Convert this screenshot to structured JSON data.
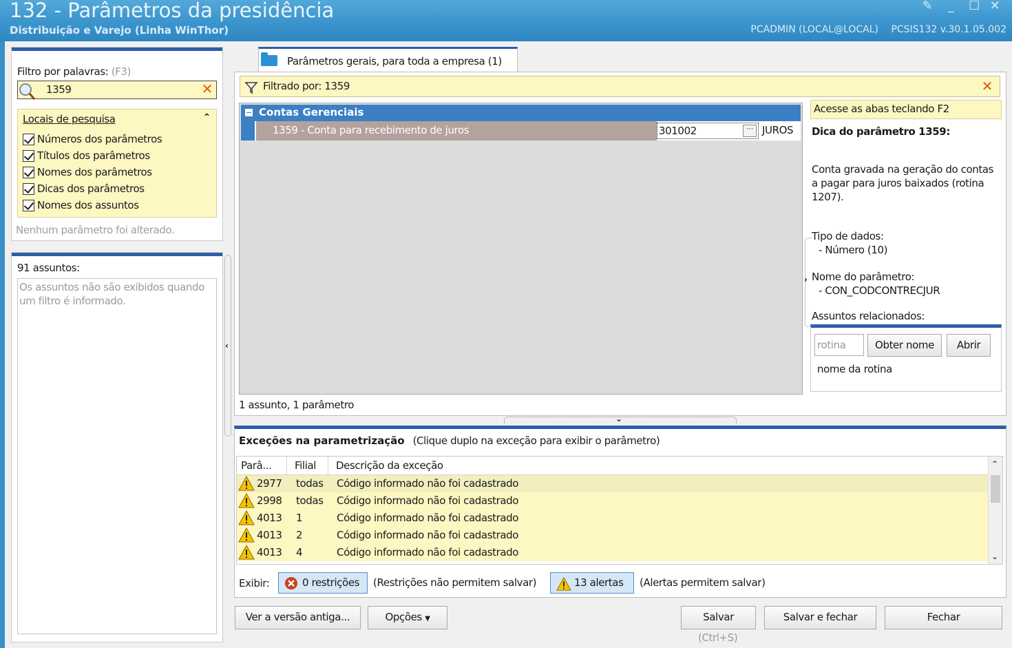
{
  "window": {
    "title": "132 - Parâmetros da presidência",
    "subtitle": "Distribuição e Varejo (Linha WinThor)",
    "user": "PCADMIN (LOCAL@LOCAL)",
    "version": "PCSIS132  v.30.1.05.002"
  },
  "filter": {
    "label": "Filtro por palavras:",
    "shortcut": "(F3)",
    "value": "1359",
    "locais_title": "Locais de pesquisa",
    "options": [
      "Números dos parâmetros",
      "Títulos dos parâmetros",
      "Nomes dos parâmetros",
      "Dicas dos parâmetros",
      "Nomes dos assuntos"
    ],
    "status": "Nenhum parâmetro foi alterado."
  },
  "assuntos": {
    "title": "91 assuntos:",
    "message": "Os assuntos não são exibidos quando um filtro é informado."
  },
  "tab": {
    "label": "Parâmetros gerais, para toda a empresa  (1)"
  },
  "filterbar": {
    "text": "Filtrado por: 1359"
  },
  "grid": {
    "group": "Contas Gerenciais",
    "param_name": "1359 - Conta para recebimento de juros",
    "param_value": "301002",
    "param_unit": "JUROS",
    "count": "1 assunto, 1 parâmetro"
  },
  "tip": {
    "access": "Acesse as abas teclando F2",
    "title": "Dica do parâmetro 1359:",
    "description": "Conta gravada na geração do contas a pagar para juros baixados (rotina 1207).",
    "tipo_label": "Tipo de dados:",
    "tipo_value": "- Número (10)",
    "nome_label": "Nome do parâmetro:",
    "nome_value": "- CON_CODCONTRECJUR",
    "assuntos_label": "Assuntos relacionados:",
    "rotina_placeholder": "rotina",
    "obter_button": "Obter nome",
    "abrir_button": "Abrir",
    "nome_rotina": "nome da rotina"
  },
  "exceptions": {
    "title": "Exceções na parametrização",
    "hint": "(Clique duplo na exceção para exibir o parâmetro)",
    "columns": [
      "Parâ...",
      "Filial",
      "Descrição da exceção"
    ],
    "rows": [
      {
        "param": "2977",
        "filial": "todas",
        "desc": "Código informado não foi cadastrado"
      },
      {
        "param": "2998",
        "filial": "todas",
        "desc": "Código informado não foi cadastrado"
      },
      {
        "param": "4013",
        "filial": "1",
        "desc": "Código informado não foi cadastrado"
      },
      {
        "param": "4013",
        "filial": "2",
        "desc": "Código informado não foi cadastrado"
      },
      {
        "param": "4013",
        "filial": "4",
        "desc": "Código informado não foi cadastrado"
      }
    ],
    "exibir_label": "Exibir:",
    "restricoes_button": "0 restrições",
    "restricoes_note": "(Restrições não permitem salvar)",
    "alertas_button": "13 alertas",
    "alertas_note": "(Alertas permitem salvar)"
  },
  "buttons": {
    "ver_versao": "Ver a versão antiga...",
    "opcoes": "Opções",
    "salvar": "Salvar",
    "salvar_shortcut": "(Ctrl+S)",
    "salvar_fechar": "Salvar e fechar",
    "fechar": "Fechar"
  },
  "colors": {
    "titlebar": "#3f97cf",
    "accent": "#2c5fa8",
    "highlight": "#fdf7c2",
    "group_row": "#3b7fc4",
    "selected_row": "#b3a29e",
    "close_x": "#e0590e"
  }
}
